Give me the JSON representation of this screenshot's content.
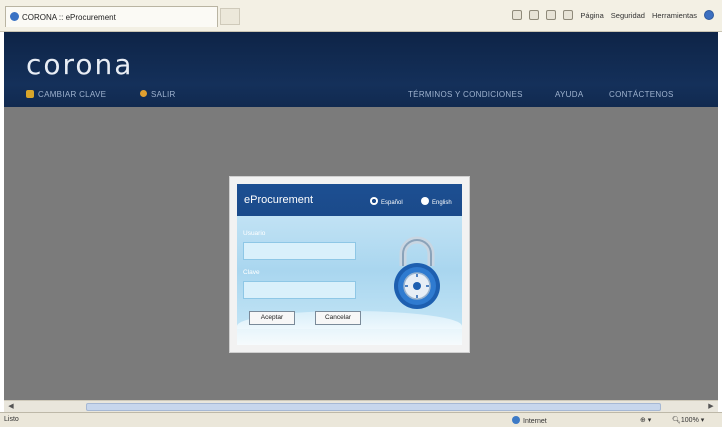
{
  "browser": {
    "tab_title": "CORONA :: eProcurement",
    "toolbar": {
      "page_label": "Página",
      "security_label": "Seguridad",
      "tools_label": "Herramientas"
    }
  },
  "header": {
    "logo": "corona",
    "change_key_label": "CAMBIAR CLAVE",
    "exit_label": "SALIR",
    "nav": [
      "TÉRMINOS Y CONDICIONES",
      "AYUDA",
      "CONTÁCTENOS"
    ]
  },
  "login": {
    "title": "eProcurement",
    "languages": [
      {
        "label": "Español",
        "selected": true
      },
      {
        "label": "English",
        "selected": false
      }
    ],
    "username_label": "Usuario",
    "username_value": "",
    "password_label": "Clave",
    "password_value": "",
    "accept_label": "Aceptar",
    "cancel_label": "Cancelar"
  },
  "status": {
    "left": "Listo",
    "zone": "Internet",
    "zoom": "100%"
  },
  "colors": {
    "header": "#14305a",
    "page_background": "#7b7b7b",
    "dialog_accent": "#1b4a8a"
  }
}
